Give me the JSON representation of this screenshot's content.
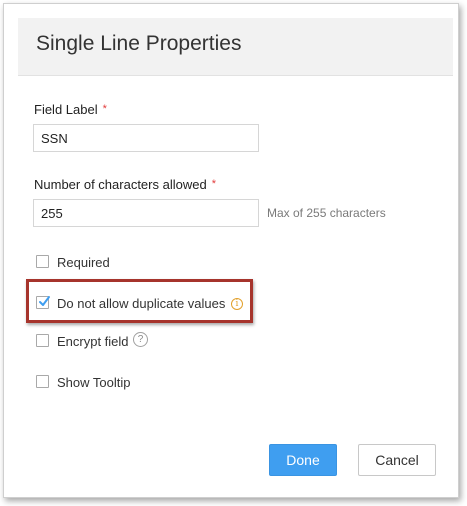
{
  "dialog": {
    "title": "Single Line Properties"
  },
  "field_label": {
    "label": "Field Label",
    "required_marker": "*",
    "value": "SSN"
  },
  "char_limit": {
    "label": "Number of characters allowed",
    "required_marker": "*",
    "value": "255",
    "hint": "Max of 255 characters"
  },
  "options": [
    {
      "label": "Required",
      "checked": false
    },
    {
      "label": "Do not allow duplicate values",
      "checked": true,
      "icon": "info-icon",
      "icon_glyph": "i"
    },
    {
      "label": "Encrypt field",
      "checked": false,
      "icon": "help-icon",
      "icon_glyph": "?"
    },
    {
      "label": "Show Tooltip",
      "checked": false
    }
  ],
  "buttons": {
    "done": "Done",
    "cancel": "Cancel"
  },
  "colors": {
    "accent": "#3f9ef0",
    "required_star": "#e23b3b",
    "highlight_border": "#a6342c",
    "info_icon": "#e2a02c",
    "header_bg": "#f2f2f2"
  }
}
